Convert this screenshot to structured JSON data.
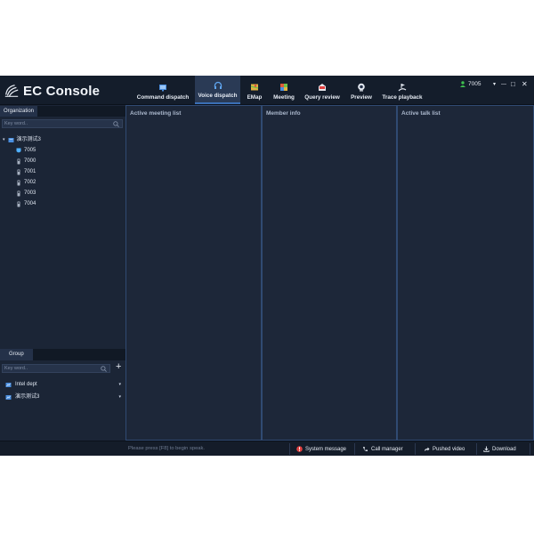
{
  "app": {
    "title": "EC Console"
  },
  "nav": [
    {
      "label": "Command dispatch",
      "icon": "command-dispatch-icon"
    },
    {
      "label": "Voice dispatch",
      "icon": "headset-icon",
      "active": true
    },
    {
      "label": "EMap",
      "icon": "map-icon"
    },
    {
      "label": "Meeting",
      "icon": "meeting-icon"
    },
    {
      "label": "Query review",
      "icon": "query-review-icon"
    },
    {
      "label": "Preview",
      "icon": "camera-icon"
    },
    {
      "label": "Trace playback",
      "icon": "trace-playback-icon"
    }
  ],
  "user": {
    "id": "7005"
  },
  "window_controls": {
    "menu": "▾",
    "minimize": "—",
    "maximize": "□",
    "close": "✕"
  },
  "organization": {
    "tab": "Organization",
    "search_placeholder": "Key word..",
    "root": {
      "label": "演示测试3",
      "expander": "▾"
    },
    "members": [
      {
        "id": "7005",
        "status": "online"
      },
      {
        "id": "7000",
        "status": "offline"
      },
      {
        "id": "7001",
        "status": "offline"
      },
      {
        "id": "7002",
        "status": "offline"
      },
      {
        "id": "7003",
        "status": "offline"
      },
      {
        "id": "7004",
        "status": "offline"
      }
    ]
  },
  "group": {
    "tab": "Group",
    "search_placeholder": "Key word..",
    "add_label": "+",
    "items": [
      {
        "label": "Intel dept",
        "caret": "▾"
      },
      {
        "label": "演示测试3",
        "caret": "▾"
      }
    ]
  },
  "panels": {
    "active_meeting": "Active meeting list",
    "member_info": "Member info",
    "active_talk": "Active talk list"
  },
  "status": {
    "hint": "Please press [F8] to begin speak.",
    "buttons": [
      {
        "label": "System message",
        "icon": "alert-icon"
      },
      {
        "label": "Call manager",
        "icon": "phone-icon"
      },
      {
        "label": "Pushed video",
        "icon": "share-icon"
      },
      {
        "label": "Download",
        "icon": "download-icon"
      }
    ]
  },
  "colors": {
    "background": "#1c2638",
    "topbar": "#141d2b",
    "accent": "#3b6fb5",
    "online": "#4fb0ff",
    "status_green": "#3fbf4f",
    "alert_red": "#e04040"
  }
}
